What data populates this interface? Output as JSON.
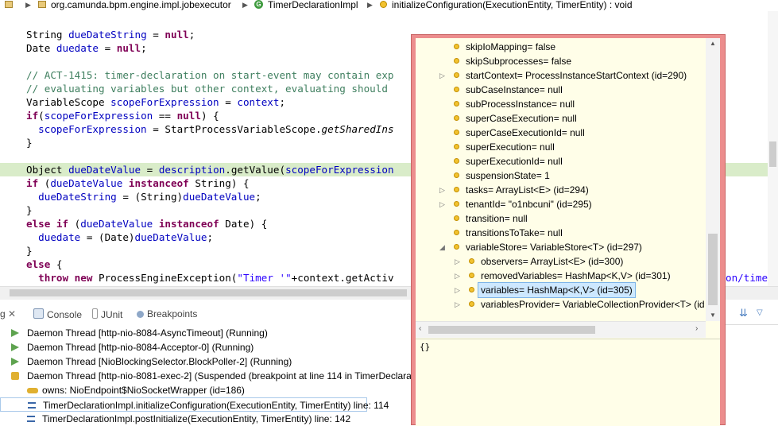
{
  "breadcrumb": {
    "package": "org.camunda.bpm.engine.impl.jobexecutor",
    "class": "TimerDeclarationImpl",
    "method": "initializeConfiguration(ExecutionEntity, TimerEntity) : void"
  },
  "code": {
    "l1a": "String ",
    "l1b": "dueDateString",
    "l1c": " = ",
    "l1d": "null",
    "l1e": ";",
    "l2a": "Date ",
    "l2b": "duedate",
    "l2c": " = ",
    "l2d": "null",
    "l2e": ";",
    "l4": "// ACT-1415: timer-declaration on start-event may contain exp",
    "l5": "// evaluating variables but other context, evaluating should",
    "l6a": "VariableScope ",
    "l6b": "scopeForExpression",
    "l6c": " = ",
    "l6d": "context",
    "l6e": ";",
    "l7a": "if",
    "l7b": "(",
    "l7c": "scopeForExpression",
    "l7d": " == ",
    "l7e": "null",
    "l7f": ") {",
    "l8a": "  scopeForExpression",
    "l8b": " = StartProcessVariableScope.",
    "l8c": "getSharedIns",
    "l9": "}",
    "l11a": "Object ",
    "l11b": "dueDateValue",
    "l11c": " = ",
    "l11d": "description",
    "l11e": ".getValue(",
    "l11f": "scopeForExpression",
    "l12a": "if",
    "l12b": " (",
    "l12c": "dueDateValue",
    "l12d": " instanceof",
    "l12e": " String) {",
    "l13a": "  dueDateString",
    "l13b": " = (String)",
    "l13c": "dueDateValue",
    "l13d": ";",
    "l14": "}",
    "l15a": "else if",
    "l15b": " (",
    "l15c": "dueDateValue",
    "l15d": " instanceof",
    "l15e": " Date) {",
    "l16a": "  duedate",
    "l16b": " = (Date)",
    "l16c": "dueDateValue",
    "l16d": ";",
    "l17": "}",
    "l18a": "else",
    "l18b": " {",
    "l19a": "  throw",
    "l19b": " new",
    "l19c": " ProcessEngineException(",
    "l19d": "\"Timer '\"",
    "l19e": "+context.getActiv",
    "overflow": "on/time"
  },
  "views": {
    "debug_tab": "g",
    "console": "Console",
    "junit": "JUnit",
    "breakpoints": "Breakpoints"
  },
  "threads": [
    "Daemon Thread [http-nio-8084-AsyncTimeout] (Running)",
    "Daemon Thread [http-nio-8084-Acceptor-0] (Running)",
    "Daemon Thread [NioBlockingSelector.BlockPoller-2] (Running)",
    "Daemon Thread [http-nio-8081-exec-2] (Suspended (breakpoint at line 114 in TimerDeclarat",
    "owns: NioEndpoint$NioSocketWrapper  (id=186)",
    "TimerDeclarationImpl.initializeConfiguration(ExecutionEntity, TimerEntity) line: 114",
    "TimerDeclarationImpl.postInitialize(ExecutionEntity, TimerEntity) line: 142"
  ],
  "variables": [
    "skipIoMapping= false",
    "skipSubprocesses= false",
    "startContext= ProcessInstanceStartContext  (id=290)",
    "subCaseInstance= null",
    "subProcessInstance= null",
    "superCaseExecution= null",
    "superCaseExecutionId= null",
    "superExecution= null",
    "superExecutionId= null",
    "suspensionState= 1",
    "tasks= ArrayList<E>  (id=294)",
    "tenantId= \"o1nbcuni\"  (id=295)",
    "transition= null",
    "transitionsToTake= null",
    "variableStore= VariableStore<T>  (id=297)",
    "observers= ArrayList<E>  (id=300)",
    "removedVariables= HashMap<K,V>  (id=301)",
    "variables= HashMap<K,V>  (id=305)",
    "variablesProvider= VariableCollectionProvider<T>  (id"
  ],
  "detail_text": "{}",
  "colors": {
    "popup_border": "#ec8d8d",
    "popup_bg": "#fffee8",
    "highlight_line": "#d9ecc9"
  }
}
